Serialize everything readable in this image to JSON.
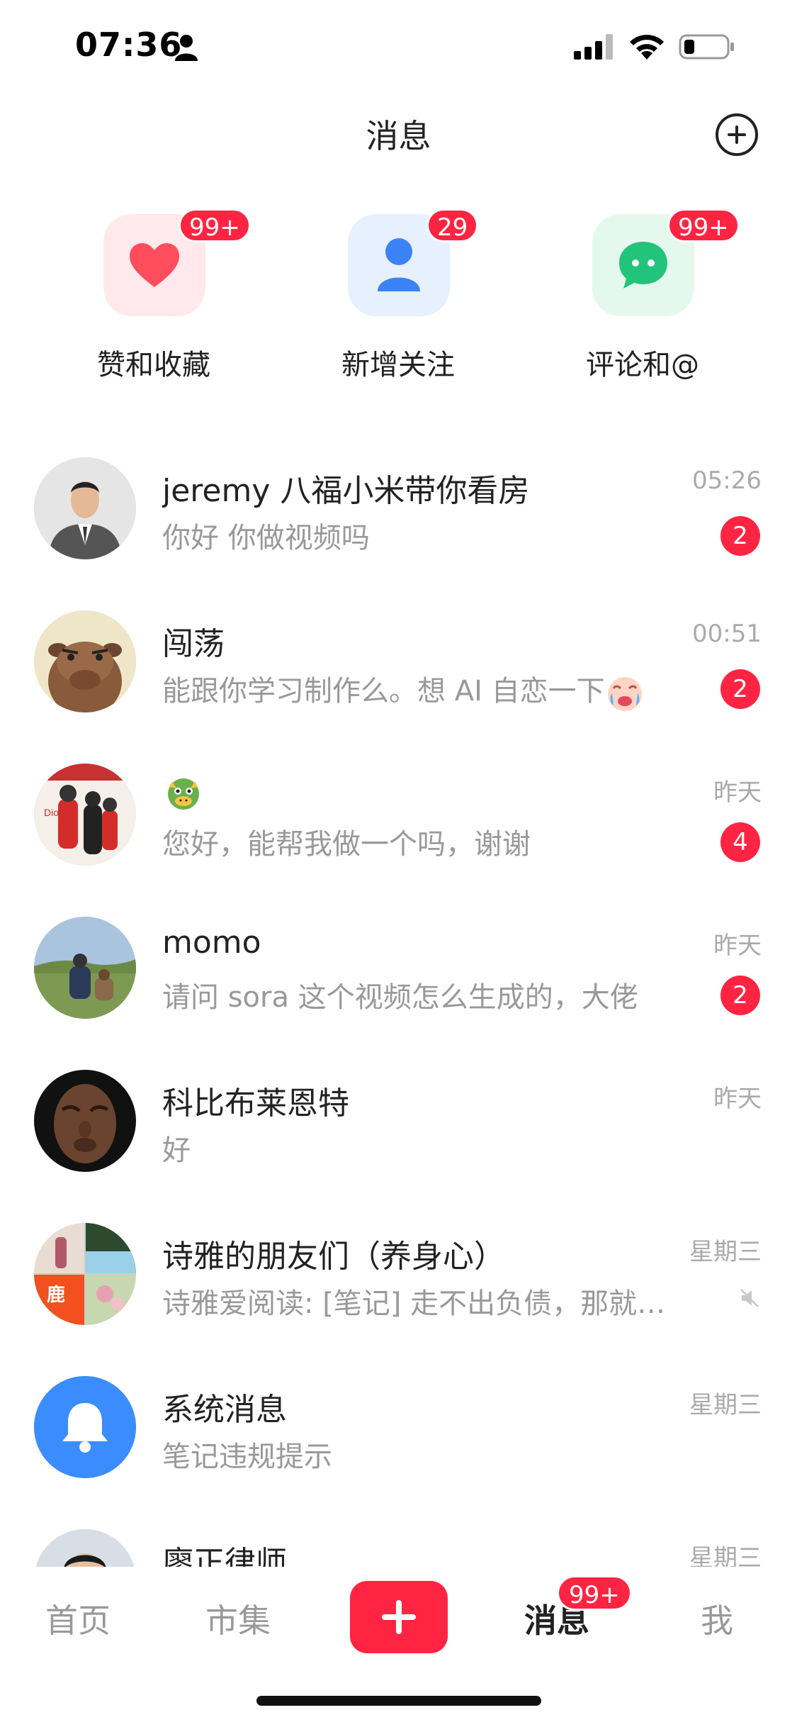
{
  "status_bar": {
    "time": "07:36"
  },
  "header": {
    "title": "消息"
  },
  "quick_actions": [
    {
      "label": "赞和收藏",
      "badge": "99+",
      "icon": "heart-icon",
      "color": "#ff4d5e"
    },
    {
      "label": "新增关注",
      "badge": "29",
      "icon": "person-icon",
      "color": "#3b82f6"
    },
    {
      "label": "评论和@",
      "badge": "99+",
      "icon": "chat-bubble-icon",
      "color": "#22c37a"
    }
  ],
  "conversations": [
    {
      "name": "jeremy 八福小米带你看房",
      "preview": "你好 你做视频吗",
      "time": "05:26",
      "badge": "2"
    },
    {
      "name": "闯荡",
      "preview": "能跟你学习制作么。想 AI 自恋一下",
      "time": "00:51",
      "badge": "2"
    },
    {
      "name": "",
      "preview": "您好，能帮我做一个吗，谢谢",
      "time": "昨天",
      "badge": "4"
    },
    {
      "name": "momo",
      "preview": "请问 sora 这个视频怎么生成的，大佬",
      "time": "昨天",
      "badge": "2"
    },
    {
      "name": "科比布莱恩特",
      "preview": "好",
      "time": "昨天"
    },
    {
      "name": "诗雅的朋友们（养身心）",
      "preview": "诗雅爱阅读: [笔记] 走不出负债，那就…",
      "time": "星期三",
      "muted": true
    },
    {
      "name": "系统消息",
      "preview": "笔记违规提示",
      "time": "星期三"
    },
    {
      "name": "廖正律师",
      "preview": "",
      "time": "星期三"
    }
  ],
  "tab_bar": {
    "tabs": [
      "首页",
      "市集",
      "消息",
      "我"
    ],
    "active": "消息",
    "messages_badge": "99+"
  },
  "colors": {
    "accent": "#ff2442",
    "text_secondary": "#999999",
    "system_avatar": "#3b8cff"
  }
}
